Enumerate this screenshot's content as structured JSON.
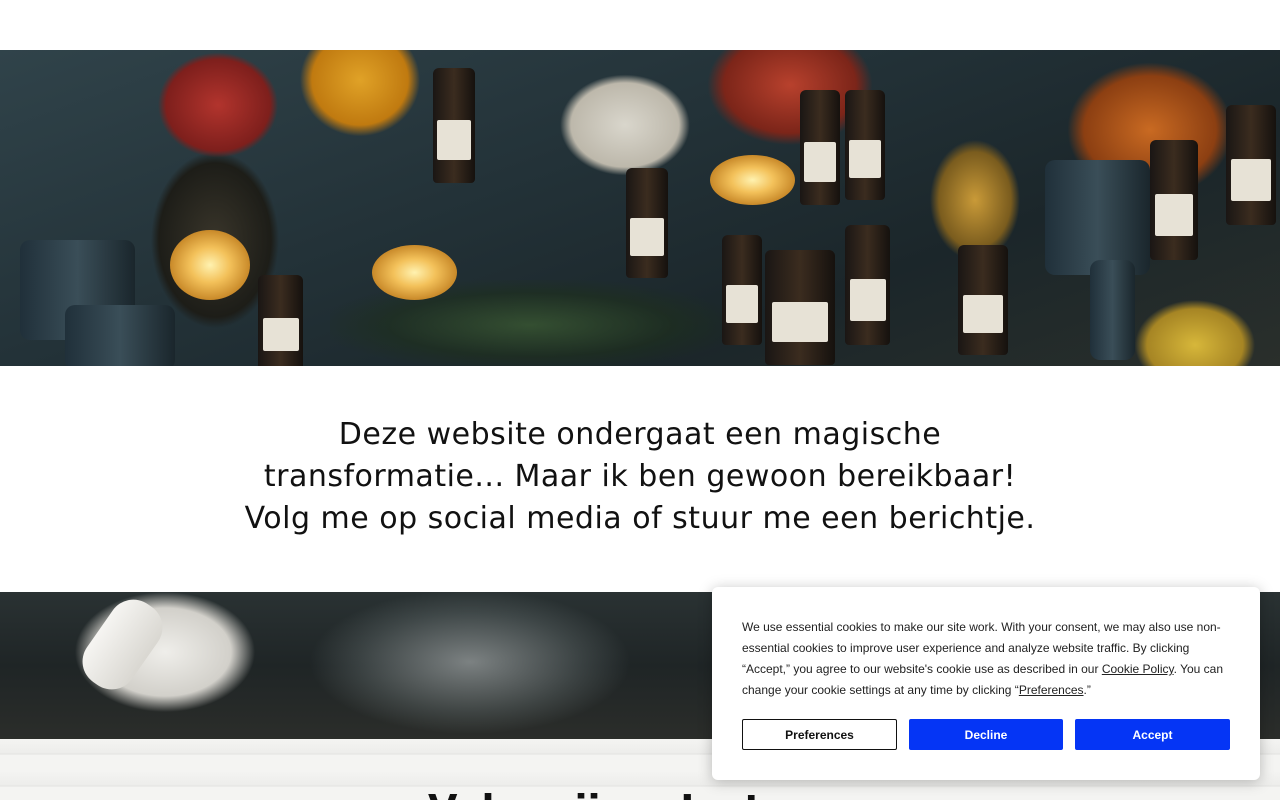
{
  "message": {
    "line1": "Deze website ondergaat een magische",
    "line2": "transformatie... Maar ik ben gewoon bereikbaar!",
    "line3": "Volg me op social media of stuur me een berichtje."
  },
  "next_section": {
    "heading_partial": "Volg mij op Insta..."
  },
  "cookie_banner": {
    "text_part1": "We use essential cookies to make our site work. With your consent, we may also use non-essential cookies to improve user experience and analyze website traffic. By clicking “Accept,” you agree to our website's cookie use as described in our ",
    "cookie_policy_link": "Cookie Policy",
    "text_part2": ". You can change your cookie settings at any time by clicking “",
    "preferences_link": "Preferences",
    "text_part3": ".”",
    "preferences_button": "Preferences",
    "decline_button": "Decline",
    "accept_button": "Accept"
  },
  "colors": {
    "primary_button": "#0535f5",
    "text": "#111111",
    "background": "#ffffff"
  }
}
